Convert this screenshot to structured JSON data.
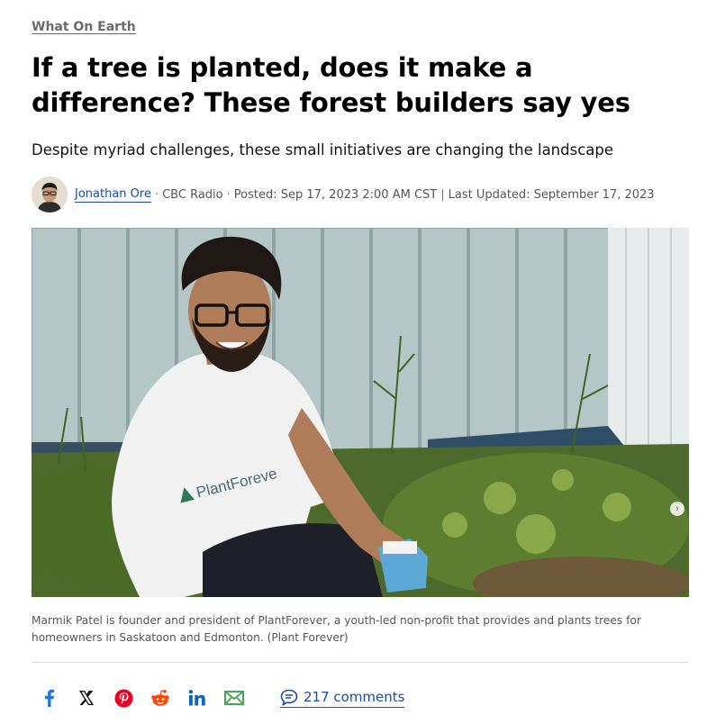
{
  "article": {
    "section": "What On Earth",
    "headline": "If a tree is planted, does it make a difference? These forest builders say yes",
    "dek": "Despite myriad challenges, these small initiatives are changing the landscape",
    "byline": {
      "author": "Jonathan Ore",
      "outlet": "CBC Radio",
      "posted": "Posted: Sep 17, 2023 2:00 AM CST",
      "divider": "|",
      "updated": "Last Updated: September 17, 2023"
    },
    "image": {
      "shirt_text": "PlantForeve",
      "caption": "Marmik Patel is founder and president of PlantForever, a youth-led non-profit that provides and plants trees for homeowners in Saskatoon and Edmonton. (Plant Forever)"
    }
  },
  "share": {
    "icons": [
      "facebook-icon",
      "x-icon",
      "pinterest-icon",
      "reddit-icon",
      "linkedin-icon",
      "email-icon"
    ],
    "comments_label": "217 comments"
  },
  "colors": {
    "link_blue": "#1c4da1",
    "facebook": "#1877f2",
    "pinterest": "#e60023",
    "reddit": "#ff4500",
    "linkedin": "#0a66c2",
    "email": "#4aa55d"
  }
}
